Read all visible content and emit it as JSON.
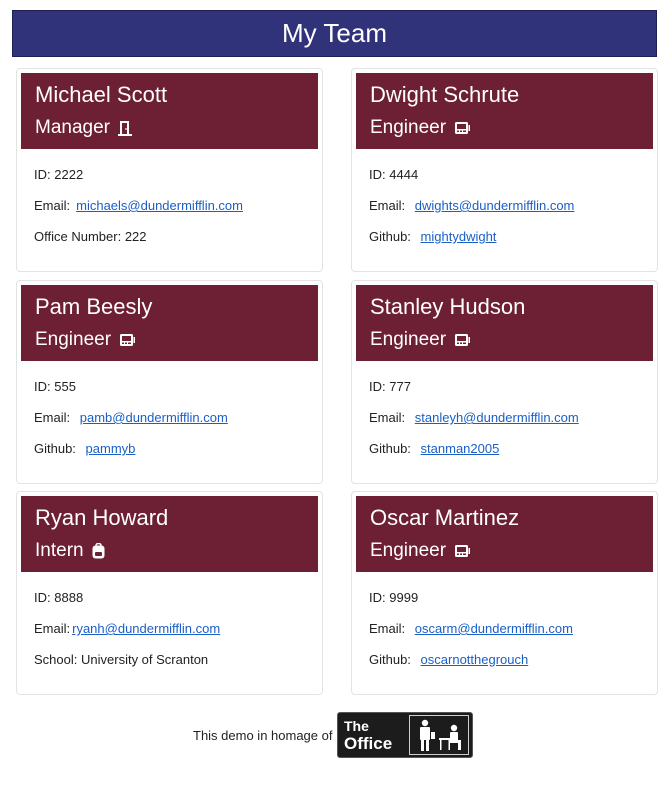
{
  "header": {
    "title": "My Team"
  },
  "employees": [
    {
      "name": "Michael Scott",
      "role": "Manager",
      "role_icon": "door-icon",
      "id_label": "ID:",
      "id": "2222",
      "email_label": "Email:",
      "email": "michaels@dundermifflin.com",
      "extra_label": "Office Number:",
      "extra_value": "222"
    },
    {
      "name": "Dwight Schrute",
      "role": "Engineer",
      "role_icon": "computer-icon",
      "id_label": "ID:",
      "id": "4444",
      "email_label": "Email:",
      "email": "dwights@dundermifflin.com",
      "extra_label": "Github:",
      "extra_value": "mightydwight"
    },
    {
      "name": "Pam Beesly",
      "role": "Engineer",
      "role_icon": "computer-icon",
      "id_label": "ID:",
      "id": "555",
      "email_label": "Email:",
      "email": "pamb@dundermifflin.com",
      "extra_label": "Github:",
      "extra_value": "pammyb"
    },
    {
      "name": "Stanley Hudson",
      "role": "Engineer",
      "role_icon": "computer-icon",
      "id_label": "ID:",
      "id": "777",
      "email_label": "Email:",
      "email": "stanleyh@dundermifflin.com",
      "extra_label": "Github:",
      "extra_value": "stanman2005"
    },
    {
      "name": "Ryan Howard",
      "role": "Intern",
      "role_icon": "backpack-icon",
      "id_label": "ID:",
      "id": "8888",
      "email_label": "Email:",
      "email": "ryanh@dundermifflin.com",
      "extra_label": "School:",
      "extra_value": "University of Scranton"
    },
    {
      "name": "Oscar Martinez",
      "role": "Engineer",
      "role_icon": "computer-icon",
      "id_label": "ID:",
      "id": "9999",
      "email_label": "Email:",
      "email": "oscarm@dundermifflin.com",
      "extra_label": "Github:",
      "extra_value": "oscarnotthegrouch"
    }
  ],
  "footer": {
    "text": "This demo in homage of",
    "logo_line1": "The",
    "logo_line2": "Office"
  },
  "colors": {
    "banner": "#30327a",
    "card_header": "#6d1f33",
    "link": "#1a5fc8"
  }
}
